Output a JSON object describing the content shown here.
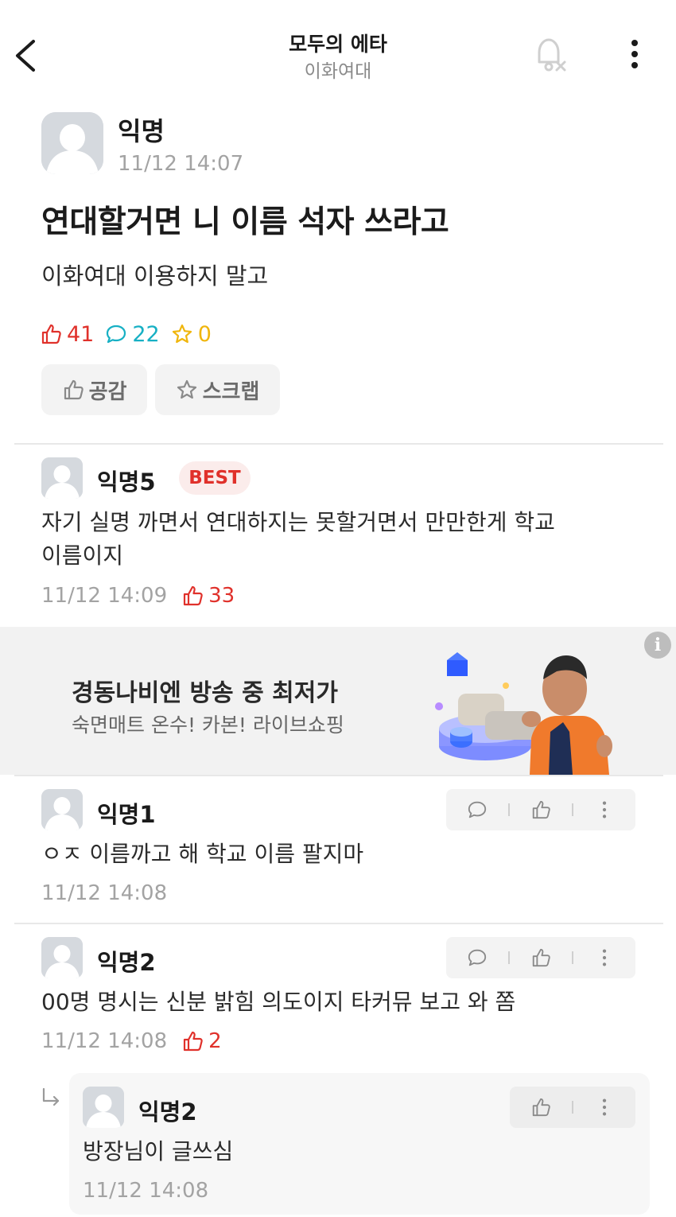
{
  "header": {
    "title": "모두의 에타",
    "subtitle": "이화여대"
  },
  "post": {
    "author": "익명",
    "time": "11/12 14:07",
    "title": "연대할거면 니 이름 석자 쓰라고",
    "body": "이화여대 이용하지 말고",
    "stats": {
      "likes": "41",
      "comments": "22",
      "scraps": "0"
    },
    "like_button": "공감",
    "scrap_button": "스크랩"
  },
  "best_comment": {
    "author": "익명5",
    "badge": "BEST",
    "body_line1": "자기 실명 까면서 연대하지는 못할거면서 만만한게 학교",
    "body_line2": "이름이지",
    "time": "11/12 14:09",
    "likes": "33"
  },
  "ad": {
    "title": "경동나비엔 방송 중 최저가",
    "subtitle": "숙면매트 온수! 카본! 라이브쇼핑",
    "info_glyph": "i"
  },
  "comments": [
    {
      "author": "익명1",
      "body": "ㅇㅈ 이름까고 해 학교 이름 팔지마",
      "time": "11/12 14:08"
    },
    {
      "author": "익명2",
      "body": "00명 명시는 신분 밝힘 의도이지 타커뮤 보고 와 쫌",
      "time": "11/12 14:08",
      "likes": "2"
    }
  ],
  "reply": {
    "author": "익명2",
    "body": "방장님이 글쓰심",
    "time": "11/12 14:08"
  },
  "colors": {
    "like": "#e0312b",
    "comment": "#17b0c4",
    "scrap": "#f0b60d",
    "muted": "#a3a3a3"
  }
}
